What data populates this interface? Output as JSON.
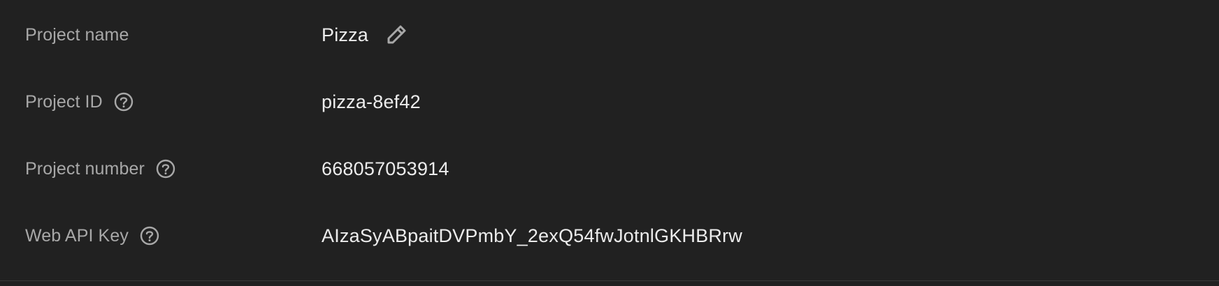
{
  "project_settings": {
    "rows": [
      {
        "label": "Project name",
        "value": "Pizza",
        "action_icon": "edit-icon"
      },
      {
        "label": "Project ID",
        "value": "pizza-8ef42",
        "help_icon": "help-circle-icon"
      },
      {
        "label": "Project number",
        "value": "668057053914",
        "help_icon": "help-circle-icon"
      },
      {
        "label": "Web API Key",
        "value": "AIzaSyABpaitDVPmbY_2exQ54fwJotnlGKHBRrw",
        "help_icon": "help-circle-icon"
      }
    ]
  },
  "colors": {
    "background": "#212121",
    "label": "#a8a8a8",
    "value": "#ececec",
    "icon": "#a8a8a8",
    "divider": "#3a3a3a"
  }
}
